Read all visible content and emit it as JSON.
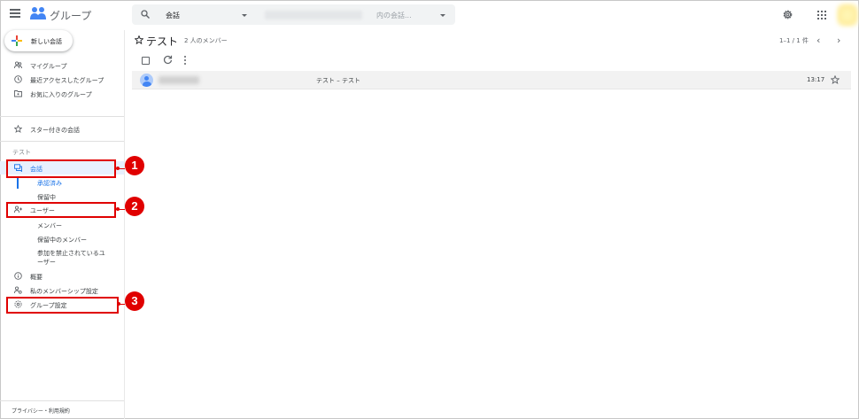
{
  "header": {
    "app_title": "グループ",
    "search": {
      "scope": "会話",
      "placeholder": "内の会話..."
    }
  },
  "sidebar": {
    "new_conversation_label": "新しい会話",
    "primary_items": [
      {
        "label": "マイグループ",
        "icon": "groups-icon"
      },
      {
        "label": "最近アクセスしたグループ",
        "icon": "clock-icon"
      },
      {
        "label": "お気に入りのグループ",
        "icon": "folder-star-icon"
      }
    ],
    "starred_label": "スター付きの会話",
    "group_section_label": "テスト",
    "group_items": {
      "conversations": "会話",
      "approved": "承認済み",
      "pending": "保留中",
      "users": "ユーザー",
      "members": "メンバー",
      "pending_members": "保留中のメンバー",
      "banned_line1": "参加を禁止されているユ",
      "banned_line2": "ーザー",
      "about": "概要",
      "membership_settings": "私のメンバーシップ設定",
      "group_settings": "グループ設定"
    },
    "footer": "プライバシー・利用規約"
  },
  "callouts": [
    "1",
    "2",
    "3"
  ],
  "main": {
    "title": "テスト",
    "member_count": "2 人のメンバー",
    "pagination": "1–1 / 1 件",
    "rows": [
      {
        "subject": "テスト – テスト",
        "time": "13:17"
      }
    ]
  },
  "colors": {
    "accent": "#1a73e8",
    "active_bg": "#e8f0fe",
    "callout": "#e00000"
  }
}
